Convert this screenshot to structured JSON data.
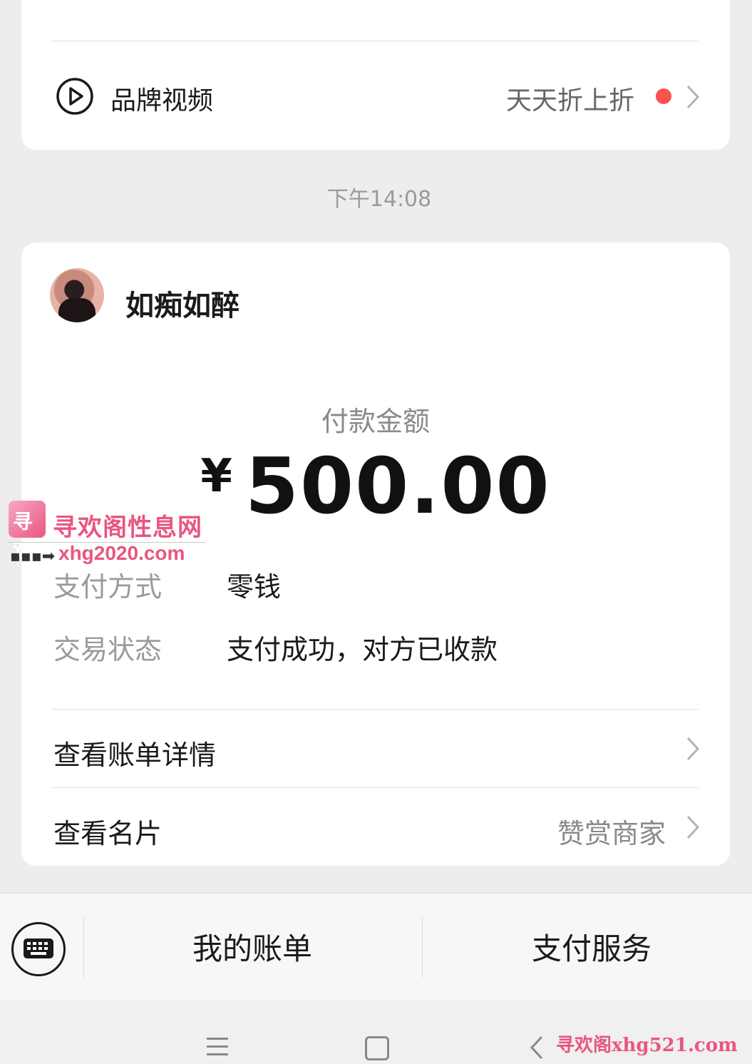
{
  "top_card": {
    "brand_label": "品牌视频",
    "promo_label": "天天折上折",
    "brand_icon": "play-circle-icon",
    "accent_red": "#fa5151"
  },
  "timestamp": "下午14:08",
  "payment_card": {
    "payee_name": "如痴如醉",
    "amount_label": "付款金额",
    "currency_symbol": "¥",
    "amount": "500.00",
    "details": [
      {
        "label": "支付方式",
        "value": "零钱"
      },
      {
        "label": "交易状态",
        "value": "支付成功，对方已收款"
      }
    ],
    "links": [
      {
        "label": "查看账单详情",
        "aside": ""
      },
      {
        "label": "查看名片",
        "aside": "赞赏商家"
      }
    ]
  },
  "watermark": {
    "logo_text": "寻欢",
    "title": "寻欢阁性息网",
    "url": "xhg2020.com",
    "bottom_text": "寻欢阁xhg521.com",
    "color": "#e8567f"
  },
  "bottom_menu": {
    "keyboard_icon": "keyboard-icon",
    "items": [
      "我的账单",
      "支付服务"
    ]
  },
  "nav_bar": {
    "icons": [
      "menu-icon",
      "home-icon",
      "back-icon"
    ]
  }
}
